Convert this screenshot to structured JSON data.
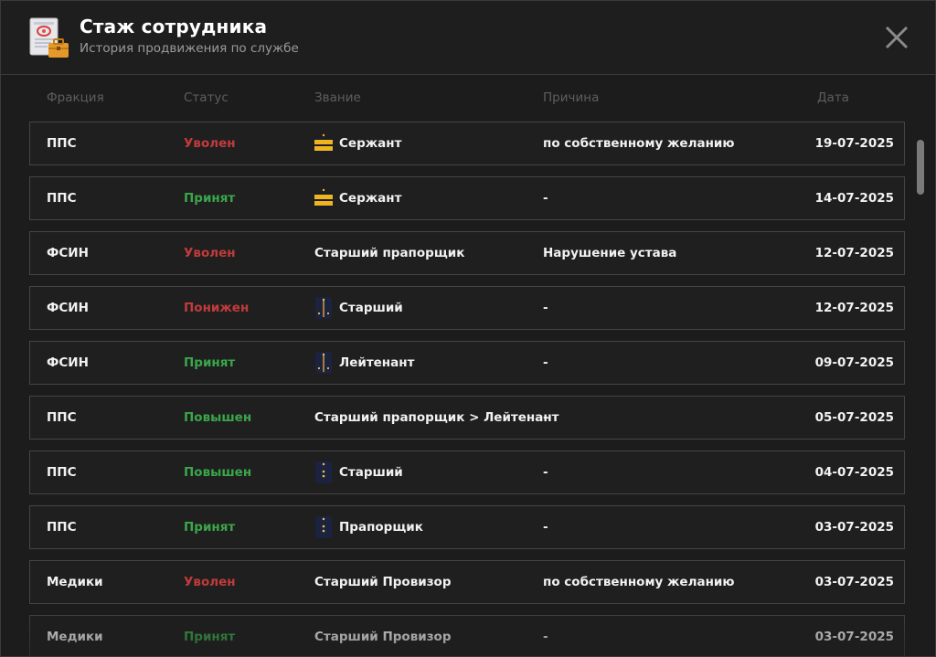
{
  "header": {
    "title": "Стаж сотрудника",
    "subtitle": "История продвижения по службе",
    "app_icon": "certificate-briefcase-icon",
    "close_icon": "close-icon"
  },
  "columns": {
    "faction": "Фракция",
    "status": "Статус",
    "rank": "Звание",
    "reason": "Причина",
    "date": "Дата"
  },
  "colors": {
    "fired": "#c23b3b",
    "positive": "#3aa64a",
    "background": "#1c1c1c",
    "row_border": "#454545"
  },
  "rows": [
    {
      "faction": "ППС",
      "status": "Уволен",
      "status_color": "red",
      "rank_icon": "gold-stripes-epaulette",
      "rank": "Сержант",
      "reason": "по собственному желанию",
      "date": "19-07-2025"
    },
    {
      "faction": "ППС",
      "status": "Принят",
      "status_color": "green",
      "rank_icon": "gold-stripes-epaulette",
      "rank": "Сержант",
      "reason": "-",
      "date": "14-07-2025"
    },
    {
      "faction": "ФСИН",
      "status": "Уволен",
      "status_color": "red",
      "rank_icon": "",
      "rank": "Старший прапорщик",
      "reason": "Нарушение устава",
      "date": "12-07-2025"
    },
    {
      "faction": "ФСИН",
      "status": "Понижен",
      "status_color": "red",
      "rank_icon": "navy-stripe-epaulette",
      "rank": "Старший",
      "reason": "-",
      "date": "12-07-2025"
    },
    {
      "faction": "ФСИН",
      "status": "Принят",
      "status_color": "green",
      "rank_icon": "navy-stripe-epaulette",
      "rank": "Лейтенант",
      "reason": "-",
      "date": "09-07-2025"
    },
    {
      "faction": "ППС",
      "status": "Повышен",
      "status_color": "green",
      "rank_icon": "",
      "rank": "Старший прапорщик > Лейтенант",
      "reason": "-",
      "date": "05-07-2025"
    },
    {
      "faction": "ППС",
      "status": "Повышен",
      "status_color": "green",
      "rank_icon": "navy-stars-epaulette",
      "rank": "Старший",
      "reason": "-",
      "date": "04-07-2025"
    },
    {
      "faction": "ППС",
      "status": "Принят",
      "status_color": "green",
      "rank_icon": "navy-stars-epaulette",
      "rank": "Прапорщик",
      "reason": "-",
      "date": "03-07-2025"
    },
    {
      "faction": "Медики",
      "status": "Уволен",
      "status_color": "red",
      "rank_icon": "",
      "rank": "Старший Провизор",
      "reason": "по собственному желанию",
      "date": "03-07-2025"
    },
    {
      "faction": "Медики",
      "status": "Принят",
      "status_color": "green",
      "rank_icon": "",
      "rank": "Старший Провизор",
      "reason": "-",
      "date": "03-07-2025"
    }
  ]
}
